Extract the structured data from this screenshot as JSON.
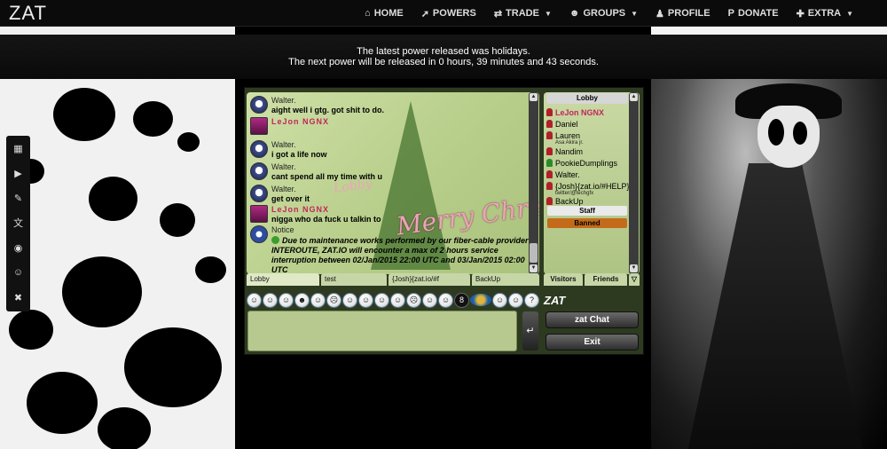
{
  "brand": "ZAT",
  "nav": [
    {
      "label": "HOME",
      "icon": "home-icon",
      "glyph": "⌂",
      "caret": false
    },
    {
      "label": "POWERS",
      "icon": "rocket-icon",
      "glyph": "➚",
      "caret": false
    },
    {
      "label": "TRADE",
      "icon": "exchange-icon",
      "glyph": "⇄",
      "caret": true
    },
    {
      "label": "GROUPS",
      "icon": "users-icon",
      "glyph": "☻",
      "caret": true
    },
    {
      "label": "PROFILE",
      "icon": "user-icon",
      "glyph": "♟",
      "caret": false
    },
    {
      "label": "DONATE",
      "icon": "paypal-icon",
      "glyph": "P",
      "caret": false
    },
    {
      "label": "EXTRA",
      "icon": "plus-icon",
      "glyph": "✚",
      "caret": true
    }
  ],
  "banner": {
    "line1": "The latest power released was holidays.",
    "line2": "The next power will be released in 0 hours, 39 minutes and 43 seconds."
  },
  "social": [
    {
      "name": "apps-icon",
      "glyph": "▦"
    },
    {
      "name": "youtube-icon",
      "glyph": "▶"
    },
    {
      "name": "brush-icon",
      "glyph": "✎"
    },
    {
      "name": "translate-icon",
      "glyph": "文"
    },
    {
      "name": "gamepad-icon",
      "glyph": "◉"
    },
    {
      "name": "smiley-icon",
      "glyph": "☺"
    },
    {
      "name": "close-icon",
      "glyph": "✖"
    }
  ],
  "chat": {
    "overlay_lobby": "Lobby",
    "overlay_greeting": "Merry Christmas",
    "messages": [
      {
        "name": "Walter.",
        "text": "aight well i gtg. got shit to do.",
        "avatar": "default"
      },
      {
        "name": "LeJon     NGNX",
        "text": "",
        "avatar": "pink",
        "fancy": true
      },
      {
        "name": "Walter.",
        "text": "i got a life now",
        "avatar": "default"
      },
      {
        "name": "Walter.",
        "text": "cant spend all my time with u",
        "avatar": "default"
      },
      {
        "name": "Walter.",
        "text": "get over it",
        "avatar": "default"
      },
      {
        "name": "LeJon     NGNX",
        "text": "nigga who da fuck u talkin to",
        "avatar": "pink",
        "fancy": true
      }
    ],
    "notice": {
      "name": "Notice",
      "text": "Due to maintenance works performed by our fiber-cable provider INTEROUTE, ZAT.IO will encounter a max of 2 hours service interruption between 02/Jan/2015 22:00 UTC and 03/Jan/2015 02:00 UTC"
    },
    "tabs": [
      "Lobby",
      "test",
      "{Josh}{zat.io/#f",
      "BackUp"
    ]
  },
  "users": {
    "header": "Lobby",
    "list": [
      {
        "name": "LeJon     NGNX",
        "status": "red"
      },
      {
        "name": "Daniel",
        "status": "red"
      },
      {
        "name": "Lauren",
        "sub": "Asa Akira jr.",
        "status": "red"
      },
      {
        "name": "Nandim",
        "status": "red"
      },
      {
        "name": "PookieDumplings",
        "status": "green"
      },
      {
        "name": "Walter.",
        "status": "red"
      },
      {
        "name": "{Josh}{zat.io/#HELP}{V",
        "sub": "twitter/@techgfx",
        "status": "red"
      },
      {
        "name": "BackUp",
        "status": "red"
      }
    ],
    "staff_label": "Staff",
    "banned_label": "Banned",
    "tabs": [
      "Visitors",
      "Friends",
      "▽"
    ]
  },
  "smilies": [
    "☺",
    "☺",
    "☺",
    "☻",
    "☺",
    "☹",
    "☺",
    "☺",
    "☺",
    "☺",
    "☹",
    "☺",
    "☺",
    "8",
    "☺",
    "☺",
    "?"
  ],
  "smilies_brand": "ZAT",
  "composer": {
    "send_glyph": "↵",
    "zat_chat_label": "zat Chat",
    "exit_label": "Exit"
  }
}
